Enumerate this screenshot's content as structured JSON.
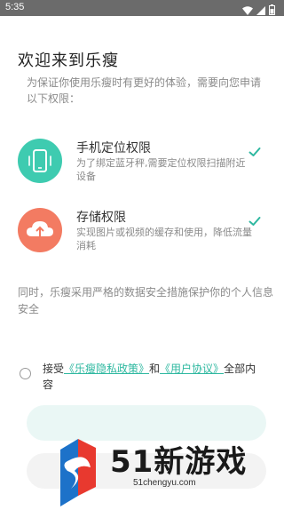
{
  "status_bar": {
    "time": "5:35"
  },
  "dialog": {
    "title": "欢迎来到乐瘦",
    "intro": "为保证你使用乐瘦时有更好的体验，需要向您申请以下权限：",
    "permissions": [
      {
        "title": "手机定位权限",
        "desc": "为了绑定蓝牙秤,需要定位权限扫描附近设备",
        "icon": "phone-location-icon",
        "color": "#3ecbb0"
      },
      {
        "title": "存储权限",
        "desc": "实现图片或视频的缓存和使用，降低流量消耗",
        "icon": "cloud-upload-icon",
        "color": "#f37b62"
      }
    ],
    "security_note": "同时，乐瘦采用严格的数据安全措施保护你的个人信息安全",
    "agree": {
      "prefix": "接受",
      "privacy_link": "《乐瘦隐私政策》",
      "and": "和",
      "terms_link": "《用户协议》",
      "suffix": "全部内容"
    },
    "accent_color": "#2eb8a0"
  },
  "watermark": {
    "brand": "51新游戏",
    "url": "51chengyu.com"
  }
}
